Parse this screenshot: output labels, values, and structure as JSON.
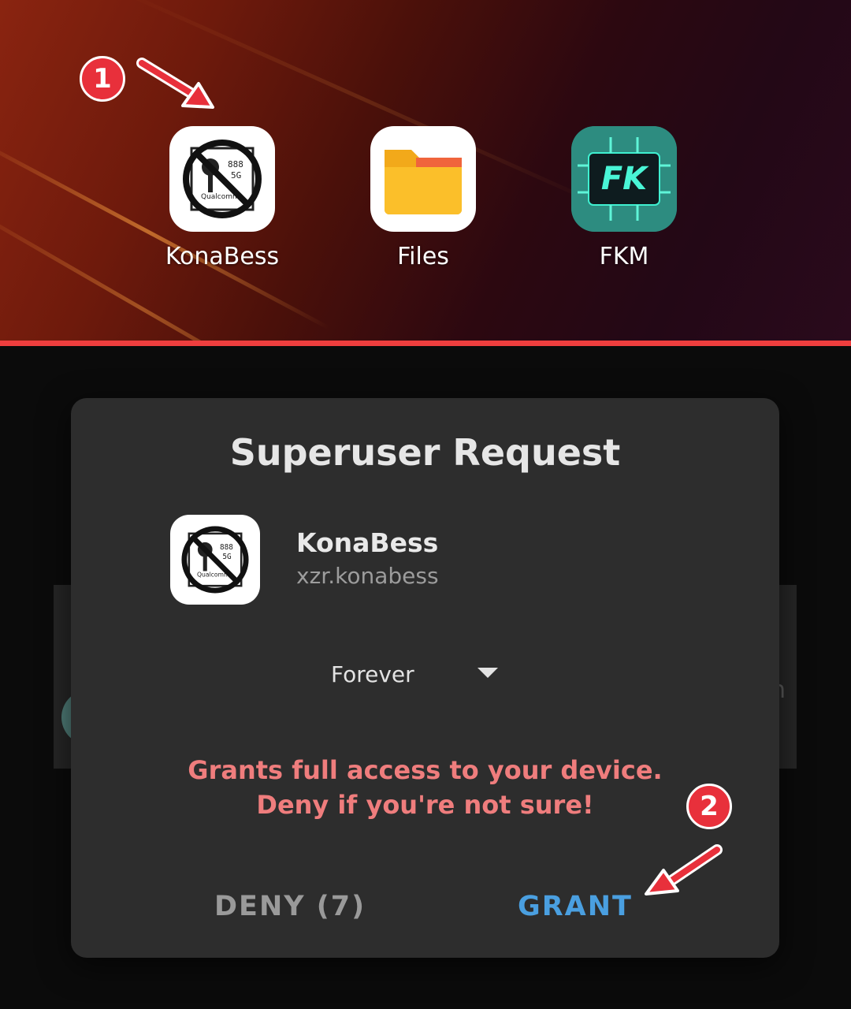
{
  "home_screen": {
    "apps": [
      {
        "label": "KonaBess",
        "icon": "konabess-chip-icon"
      },
      {
        "label": "Files",
        "icon": "folder-icon"
      },
      {
        "label": "FKM",
        "icon": "fkm-icon"
      }
    ],
    "step_badge": "1"
  },
  "dialog": {
    "title": "Superuser Request",
    "app_name": "KonaBess",
    "package": "xzr.konabess",
    "duration_selected": "Forever",
    "warning_line1": "Grants full access to your device.",
    "warning_line2": "Deny if you're not sure!",
    "deny_label": "DENY (7)",
    "grant_label": "GRANT",
    "step_badge": "2"
  },
  "colors": {
    "accent_grant": "#4a9fe0",
    "warning_text": "#ef7d7d",
    "annotation_red": "#e8303b",
    "divider_red": "#ef3e3e"
  }
}
